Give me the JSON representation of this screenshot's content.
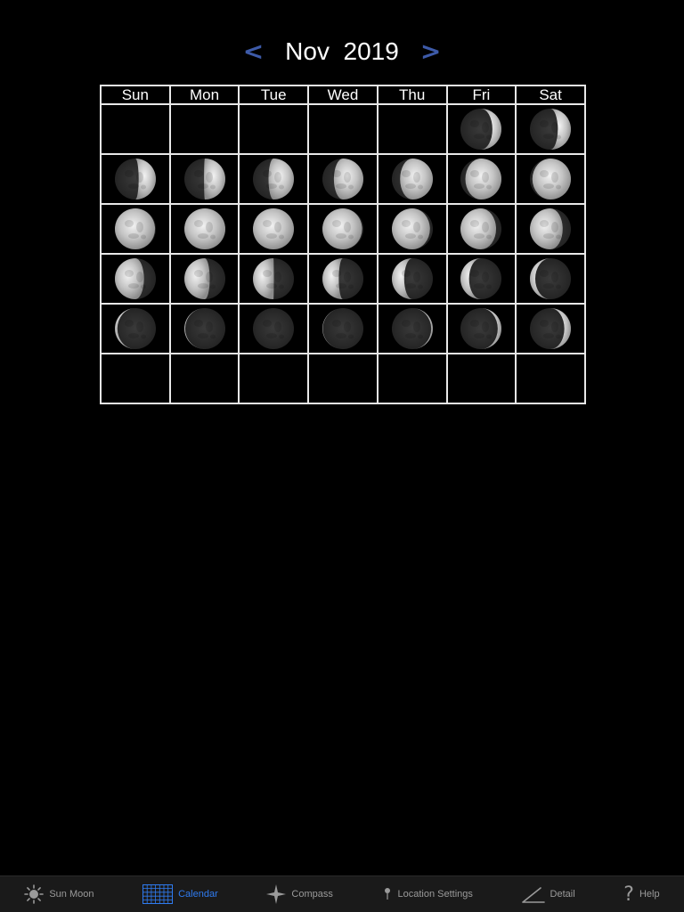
{
  "header": {
    "prev_label": "<",
    "title": "Nov  2019",
    "next_label": ">"
  },
  "calendar": {
    "weekdays": [
      "Sun",
      "Mon",
      "Tue",
      "Wed",
      "Thu",
      "Fri",
      "Sat"
    ],
    "weeks": [
      [
        null,
        null,
        null,
        null,
        null,
        {
          "phase": "waxing-crescent",
          "illum": 0.22
        },
        {
          "phase": "waxing-crescent",
          "illum": 0.32
        }
      ],
      [
        {
          "phase": "waxing-crescent",
          "illum": 0.42
        },
        {
          "phase": "first-quarter",
          "illum": 0.52
        },
        {
          "phase": "waxing-gibbous",
          "illum": 0.62
        },
        {
          "phase": "waxing-gibbous",
          "illum": 0.72
        },
        {
          "phase": "waxing-gibbous",
          "illum": 0.8
        },
        {
          "phase": "waxing-gibbous",
          "illum": 0.88
        },
        {
          "phase": "waxing-gibbous",
          "illum": 0.94
        }
      ],
      [
        {
          "phase": "full",
          "illum": 0.98
        },
        {
          "phase": "full",
          "illum": 1.0
        },
        {
          "phase": "full",
          "illum": 1.0
        },
        {
          "phase": "waning-gibbous",
          "illum": 0.97
        },
        {
          "phase": "waning-gibbous",
          "illum": 0.93
        },
        {
          "phase": "waning-gibbous",
          "illum": 0.87
        },
        {
          "phase": "waning-gibbous",
          "illum": 0.8
        }
      ],
      [
        {
          "phase": "waning-gibbous",
          "illum": 0.71
        },
        {
          "phase": "third-quarter",
          "illum": 0.62
        },
        {
          "phase": "waning-crescent",
          "illum": 0.5
        },
        {
          "phase": "waning-crescent",
          "illum": 0.4
        },
        {
          "phase": "waning-crescent",
          "illum": 0.3
        },
        {
          "phase": "waning-crescent",
          "illum": 0.21
        },
        {
          "phase": "waning-crescent",
          "illum": 0.13
        }
      ],
      [
        {
          "phase": "waning-crescent",
          "illum": 0.06
        },
        {
          "phase": "new",
          "illum": 0.02
        },
        {
          "phase": "new",
          "illum": 0.0
        },
        {
          "phase": "new",
          "illum": 0.01
        },
        {
          "phase": "waxing-crescent",
          "illum": 0.04
        },
        {
          "phase": "waxing-crescent",
          "illum": 0.09
        },
        {
          "phase": "waxing-crescent",
          "illum": 0.16
        }
      ],
      [
        null,
        null,
        null,
        null,
        null,
        null,
        null
      ]
    ]
  },
  "tabs": [
    {
      "label": "Sun Moon",
      "icon": "sun-icon",
      "active": false
    },
    {
      "label": "Calendar",
      "icon": "calendar-grid-icon",
      "active": true
    },
    {
      "label": "Compass",
      "icon": "compass-star-icon",
      "active": false
    },
    {
      "label": "Location Settings",
      "icon": "location-pin-icon",
      "active": false
    },
    {
      "label": "Detail",
      "icon": "angle-icon",
      "active": false
    },
    {
      "label": "Help",
      "icon": "question-mark-icon",
      "active": false
    }
  ],
  "colors": {
    "accent": "#2f7bf0",
    "nav_arrow": "#3d5aa8",
    "grid": "#e8e8e8",
    "background": "#000000"
  }
}
